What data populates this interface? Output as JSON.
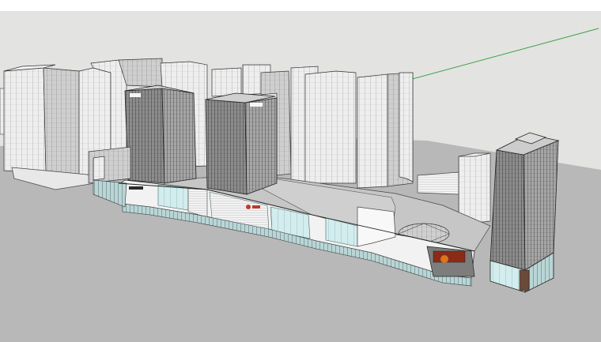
{
  "app": {
    "window_title": "",
    "view_type": "3D perspective model view"
  },
  "scene": {
    "sky_color": "#e3e3e1",
    "ground_color": "#b8b8b8",
    "sky_line_color": "#e8e8e8",
    "axis_color": "#3aa04a",
    "facade_light": "#eeeeee",
    "facade_dark": "#8a8a8a",
    "glass_color": "#cfe9ea",
    "sign_color": "#c0392b",
    "signage_text": ""
  }
}
